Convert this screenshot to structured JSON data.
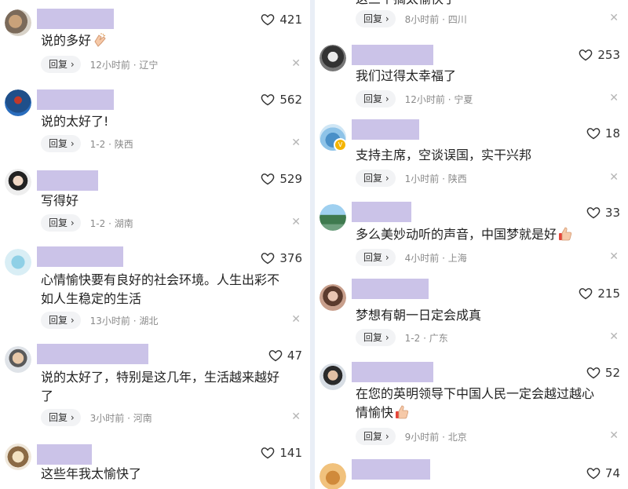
{
  "left": [
    {
      "likes": "421",
      "text": "说的多好",
      "time": "12小时前",
      "region": "辽宁",
      "emoji": "clapping-hands-icon"
    },
    {
      "likes": "562",
      "text": "说的太好了!",
      "time": "1-2",
      "region": "陕西"
    },
    {
      "likes": "529",
      "text": "写得好",
      "time": "1-2",
      "region": "湖南"
    },
    {
      "likes": "376",
      "text_line1": "心情愉快要有良好的社会环境。人生出彩不",
      "text_line2": "如人生稳定的生活",
      "time": "13小时前",
      "region": "湖北"
    },
    {
      "likes": "47",
      "text_line1": "说的太好了，特别是这几年，生活越来越好",
      "text_line2": "了",
      "time": "3小时前",
      "region": "河南"
    },
    {
      "likes": "141",
      "text": "这些年我太愉快了"
    }
  ],
  "right": [
    {
      "text_partial": "这三个搞太愉快了",
      "time": "8小时前",
      "region": "四川"
    },
    {
      "likes": "253",
      "text": "我们过得太幸福了",
      "time": "12小时前",
      "region": "宁夏"
    },
    {
      "likes": "18",
      "text": "支持主席，空谈误国，实干兴邦",
      "time": "1小时前",
      "region": "陕西"
    },
    {
      "likes": "33",
      "text": "多么美妙动听的声音，中国梦就是好",
      "time": "4小时前",
      "region": "上海",
      "emoji": "thumbs-up-icon"
    },
    {
      "likes": "215",
      "text": "梦想有朝一日定会成真",
      "time": "1-2",
      "region": "广东"
    },
    {
      "likes": "52",
      "text_line1": "在您的英明领导下中国人民一定会越过越心",
      "text_line2": "情愉快",
      "time": "9小时前",
      "region": "北京",
      "emoji": "thumbs-up-icon"
    },
    {
      "likes": "74"
    }
  ],
  "ui": {
    "reply_label": "回复",
    "chevron": "›",
    "separator": " · ",
    "close_glyph": "✕"
  },
  "colors": {
    "name_placeholder": "#cbc3e8",
    "reply_bg": "#f2f3f5",
    "meta_text": "#8a8a8a",
    "divider": "#e9eef6"
  }
}
